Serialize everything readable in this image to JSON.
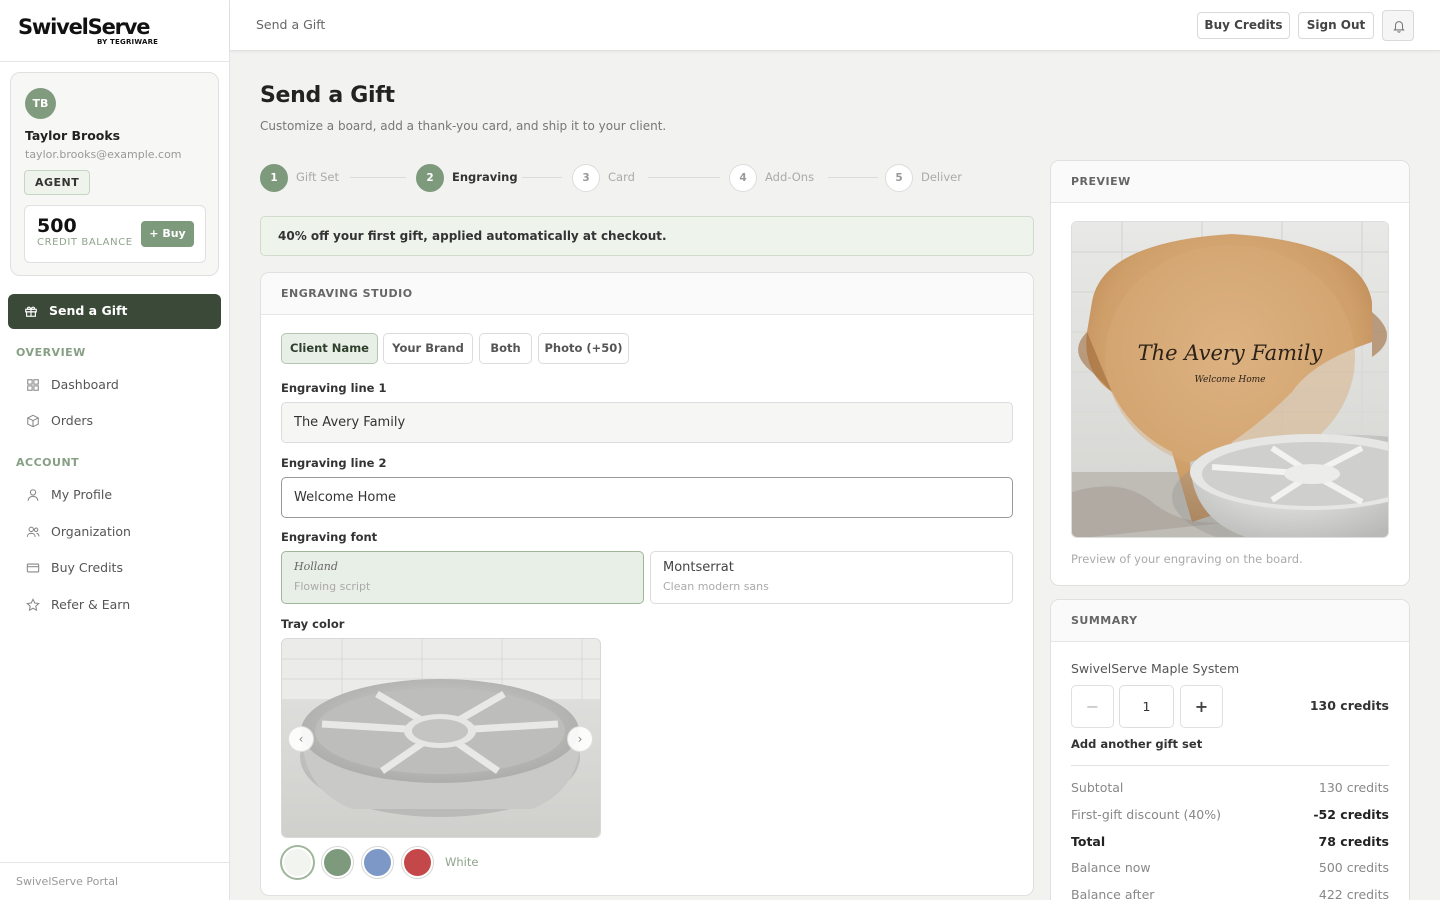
{
  "brand": {
    "name": "SwivelServe",
    "byline": "BY TEGRIWARE"
  },
  "user": {
    "initials": "TB",
    "name": "Taylor Brooks",
    "email": "taylor.brooks@example.com",
    "role": "AGENT"
  },
  "credits": {
    "amount": "500",
    "label": "CREDIT BALANCE",
    "buy_label": "+ Buy"
  },
  "nav": {
    "primary": "Send a Gift",
    "overview_label": "OVERVIEW",
    "overview_items": [
      {
        "label": "Dashboard",
        "icon": "grid-icon"
      },
      {
        "label": "Orders",
        "icon": "box-icon"
      }
    ],
    "account_label": "ACCOUNT",
    "account_items": [
      {
        "label": "My Profile",
        "icon": "user-icon"
      },
      {
        "label": "Organization",
        "icon": "users-icon"
      },
      {
        "label": "Buy Credits",
        "icon": "card-icon"
      },
      {
        "label": "Refer & Earn",
        "icon": "star-icon"
      }
    ],
    "footer": "SwivelServe Portal"
  },
  "topbar": {
    "title": "Send a Gift",
    "buy_credits": "Buy Credits",
    "sign_out": "Sign Out"
  },
  "page": {
    "title": "Send a Gift",
    "subtitle": "Customize a board, add a thank-you card, and ship it to your client."
  },
  "steps": [
    {
      "num": "1",
      "label": "Gift Set",
      "state": "done"
    },
    {
      "num": "2",
      "label": "Engraving",
      "state": "current"
    },
    {
      "num": "3",
      "label": "Card",
      "state": "todo"
    },
    {
      "num": "4",
      "label": "Add-Ons",
      "state": "todo"
    },
    {
      "num": "5",
      "label": "Deliver",
      "state": "todo"
    }
  ],
  "promo": "40% off your first gift, applied automatically at checkout.",
  "engraving": {
    "header": "ENGRAVING STUDIO",
    "tabs": [
      "Client Name",
      "Your Brand",
      "Both",
      "Photo (+50)"
    ],
    "active_tab": "Client Name",
    "line1_label": "Engraving line 1",
    "line1_value": "The Avery Family",
    "line2_label": "Engraving line 2",
    "line2_value": "Welcome Home",
    "font_label": "Engraving font",
    "fonts": [
      {
        "name": "Holland",
        "desc": "Flowing script",
        "selected": true
      },
      {
        "name": "Montserrat",
        "desc": "Clean modern sans",
        "selected": false
      }
    ],
    "tray_label": "Tray color",
    "prev_label": "‹",
    "next_label": "›",
    "swatches": [
      "#f2f4f0",
      "#7e9a7c",
      "#7d97c6",
      "#c4474a"
    ],
    "selected_color": "White"
  },
  "preview": {
    "header": "PREVIEW",
    "engraving_line1": "The Avery Family",
    "engraving_line2": "Welcome Home",
    "caption": "Preview of your engraving on the board."
  },
  "summary": {
    "header": "SUMMARY",
    "product": "SwivelServe Maple System",
    "minus": "−",
    "plus": "+",
    "quantity": "1",
    "line_price": "130 credits",
    "add_set": "Add another gift set",
    "rows": [
      {
        "label": "Subtotal",
        "value": "130 credits"
      },
      {
        "label": "First-gift discount (40%)",
        "value": "-52 credits"
      },
      {
        "label": "Total",
        "value": "78 credits"
      },
      {
        "label": "Balance now",
        "value": "500 credits"
      },
      {
        "label": "Balance after",
        "value": "422 credits"
      }
    ]
  },
  "colors": {
    "accent": "#7e9a7c",
    "primary_dark": "#3b4a38",
    "accent_light": "#e8efe6"
  }
}
